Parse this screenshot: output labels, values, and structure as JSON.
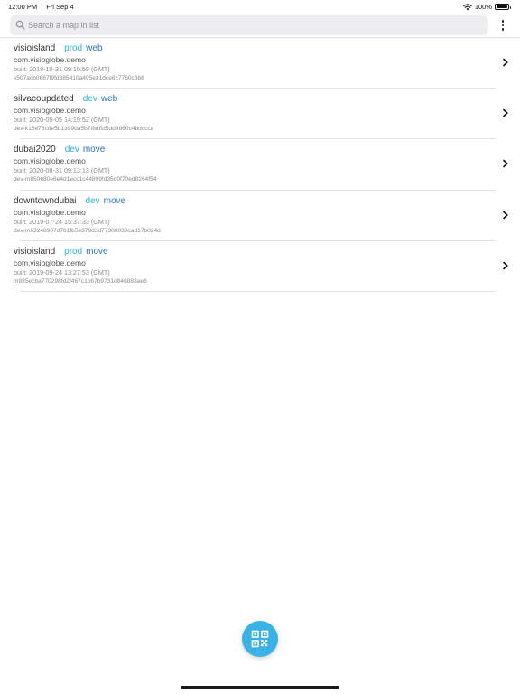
{
  "status_bar": {
    "time": "12:00 PM",
    "date": "Fri Sep 4",
    "battery": "100%"
  },
  "search": {
    "placeholder": "Search a map in list",
    "value": ""
  },
  "maps": [
    {
      "name": "visioisland",
      "env": "prod",
      "type": "web",
      "package": "com.visioglobe.demo",
      "built": "built: 2018-10-31 09:10:59 (GMT)",
      "hash": "k507acb0687f9fd385410a495e31dce6c7760c3b6"
    },
    {
      "name": "silvacoupdated",
      "env": "dev",
      "type": "web",
      "package": "com.visioglobe.demo",
      "built": "built: 2020-05-05 14:19:52 (GMT)",
      "hash": "dev-k15e78c8e5b1399da5b7f8dffd5dd9860c4bdccca"
    },
    {
      "name": "dubai2020",
      "env": "dev",
      "type": "move",
      "package": "com.visioglobe.demo",
      "built": "built: 2020-08-31 09:13:13 (GMT)",
      "hash": "dev-m850680e6e4d1ecc1c44899fd35d0f70ed8264f54"
    },
    {
      "name": "downtowndubai",
      "env": "dev",
      "type": "move",
      "package": "com.visioglobe.demo",
      "built": "built: 2019-07-24 15:37:33 (GMT)",
      "hash": "dev-m63248907d761fb5e379d3d77308039cad17b024d"
    },
    {
      "name": "visioisland",
      "env": "prod",
      "type": "move",
      "package": "com.visioglobe.demo",
      "built": "built: 2019-09-24 13:27:53 (GMT)",
      "hash": "m935ecba770298fd2f467c1b67b9731d846883ae6"
    }
  ],
  "icons": {
    "search": "search-icon",
    "menu": "more-vertical-icon",
    "chevron": "chevron-right-icon",
    "qr": "qr-code-icon"
  },
  "colors": {
    "env_tag": "#25b4e0",
    "type_tag": "#2d74b6",
    "fab": "#3bb2e6"
  }
}
